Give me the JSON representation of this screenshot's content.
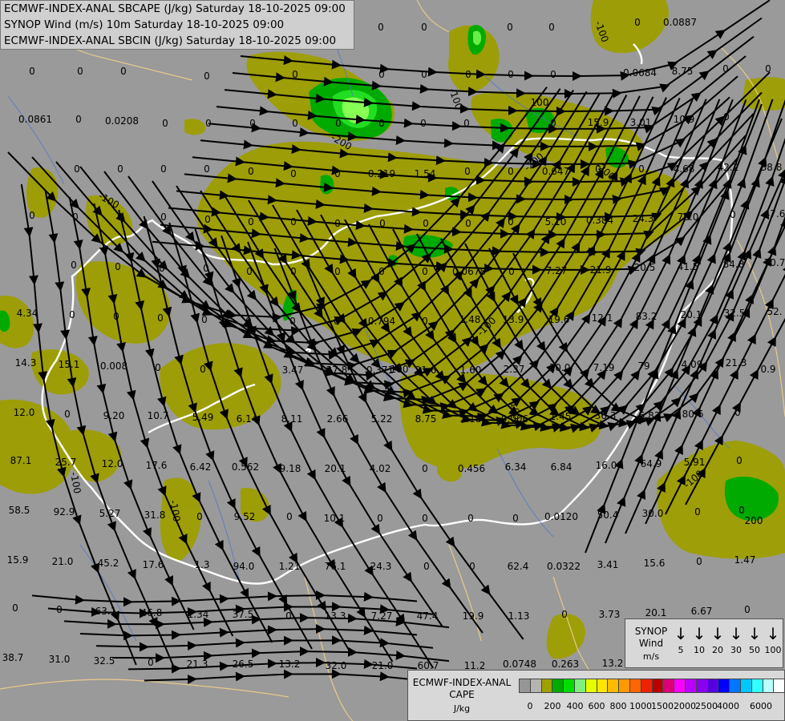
{
  "header": {
    "line1": "ECMWF-INDEX-ANAL SBCAPE (J/kg) Saturday 18-10-2025 09:00",
    "line2": "SYNOP Wind (m/s) 10m Saturday 18-10-2025 09:00",
    "line3": "ECMWF-INDEX-ANAL SBCIN (J/kg) Saturday 18-10-2025 09:00"
  },
  "station_values": [
    [
      "0",
      40,
      93
    ],
    [
      "0",
      100,
      93
    ],
    [
      "0",
      154,
      93
    ],
    [
      "0",
      258,
      99
    ],
    [
      "0",
      368,
      97
    ],
    [
      "0",
      475,
      38
    ],
    [
      "0",
      529,
      38
    ],
    [
      "0",
      636,
      38
    ],
    [
      "0",
      688,
      38
    ],
    [
      "0",
      476,
      97
    ],
    [
      "0",
      529,
      97
    ],
    [
      "0",
      584,
      97
    ],
    [
      "0",
      637,
      97
    ],
    [
      "0",
      690,
      97
    ],
    [
      "0.0887",
      848,
      32
    ],
    [
      "0",
      795,
      32
    ],
    [
      "0.0684",
      798,
      95
    ],
    [
      "8.75",
      851,
      93
    ],
    [
      "0",
      905,
      90
    ],
    [
      "0",
      958,
      90
    ],
    [
      "0.0861",
      44,
      153
    ],
    [
      "0",
      98,
      153
    ],
    [
      "0.0208",
      152,
      155
    ],
    [
      "0",
      206,
      158
    ],
    [
      "0",
      260,
      158
    ],
    [
      "0",
      315,
      158
    ],
    [
      "0",
      368,
      158
    ],
    [
      "0",
      422,
      158
    ],
    [
      "0",
      476,
      158
    ],
    [
      "0",
      528,
      158
    ],
    [
      "0",
      582,
      158
    ],
    [
      "100",
      673,
      132
    ],
    [
      "0",
      690,
      158
    ],
    [
      "15.9",
      746,
      157
    ],
    [
      "3.01",
      799,
      157
    ],
    [
      "10.9",
      853,
      153
    ],
    [
      "0",
      906,
      150
    ],
    [
      "0",
      96,
      215
    ],
    [
      "0",
      150,
      215
    ],
    [
      "0",
      204,
      215
    ],
    [
      "0",
      258,
      215
    ],
    [
      "0",
      313,
      218
    ],
    [
      "0",
      366,
      221
    ],
    [
      "0",
      421,
      221
    ],
    [
      "0.219",
      476,
      221
    ],
    [
      "1.54",
      530,
      221
    ],
    [
      "0",
      583,
      218
    ],
    [
      "0",
      637,
      218
    ],
    [
      "0.647",
      693,
      218
    ],
    [
      "0",
      746,
      215
    ],
    [
      "0",
      800,
      215
    ],
    [
      "4.68",
      853,
      215
    ],
    [
      "42.2",
      908,
      213
    ],
    [
      "38.8",
      962,
      213
    ],
    [
      "0",
      40,
      273
    ],
    [
      "0",
      94,
      275
    ],
    [
      "0",
      150,
      275
    ],
    [
      "0",
      204,
      275
    ],
    [
      "0",
      259,
      278
    ],
    [
      "0",
      313,
      281
    ],
    [
      "0",
      366,
      281
    ],
    [
      "0",
      421,
      283
    ],
    [
      "0",
      477,
      283
    ],
    [
      "0",
      531,
      283
    ],
    [
      "0",
      584,
      283
    ],
    [
      "0",
      637,
      281
    ],
    [
      "5.10",
      693,
      281
    ],
    [
      "0.384",
      748,
      279
    ],
    [
      "24.3",
      802,
      277
    ],
    [
      "76.0",
      858,
      275
    ],
    [
      "0",
      914,
      272
    ],
    [
      "47.6",
      966,
      271
    ],
    [
      "0",
      92,
      335
    ],
    [
      "0",
      147,
      337
    ],
    [
      "0",
      202,
      339
    ],
    [
      "0",
      257,
      339
    ],
    [
      "0",
      311,
      343
    ],
    [
      "0",
      366,
      343
    ],
    [
      "0",
      421,
      343
    ],
    [
      "0",
      476,
      343
    ],
    [
      "0",
      530,
      343
    ],
    [
      "0.0678",
      585,
      343
    ],
    [
      "0",
      638,
      343
    ],
    [
      "7.27",
      694,
      342
    ],
    [
      "21.9",
      749,
      341
    ],
    [
      "20.5",
      804,
      338
    ],
    [
      "41.5",
      858,
      337
    ],
    [
      "84.8",
      915,
      334
    ],
    [
      "70.7",
      966,
      332
    ],
    [
      "4.34",
      34,
      395
    ],
    [
      "0",
      90,
      397
    ],
    [
      "0",
      145,
      399
    ],
    [
      "0",
      200,
      401
    ],
    [
      "0",
      255,
      403
    ],
    [
      "0",
      310,
      405
    ],
    [
      "0",
      365,
      405
    ],
    [
      "0",
      420,
      405
    ],
    [
      "0.794",
      476,
      405
    ],
    [
      "0",
      530,
      405
    ],
    [
      "1.48",
      586,
      403
    ],
    [
      "13.9",
      640,
      403
    ],
    [
      "19.6",
      697,
      403
    ],
    [
      "12.1",
      751,
      401
    ],
    [
      "83.2",
      806,
      399
    ],
    [
      "20.1",
      862,
      397
    ],
    [
      "32.5",
      916,
      395
    ],
    [
      "52.",
      966,
      393
    ],
    [
      "14.3",
      32,
      457
    ],
    [
      "15.1",
      86,
      459
    ],
    [
      "0.008",
      142,
      461
    ],
    [
      "0",
      197,
      463
    ],
    [
      "0",
      253,
      465
    ],
    [
      "3.47",
      365,
      466
    ],
    [
      "27.8",
      420,
      466
    ],
    [
      "0.371",
      474,
      466
    ],
    [
      "100",
      498,
      465
    ],
    [
      "21.6",
      531,
      466
    ],
    [
      "1.60",
      587,
      466
    ],
    [
      "2.37",
      641,
      465
    ],
    [
      "10.0",
      698,
      463
    ],
    [
      "7.19",
      753,
      463
    ],
    [
      "79",
      803,
      461
    ],
    [
      "4.09",
      863,
      459
    ],
    [
      "21.3",
      918,
      457
    ],
    [
      "0.9",
      958,
      465
    ],
    [
      "12.0",
      30,
      519
    ],
    [
      "0",
      84,
      521
    ],
    [
      "9.20",
      142,
      523
    ],
    [
      "10.7",
      197,
      523
    ],
    [
      "5.49",
      253,
      525
    ],
    [
      "6.14",
      308,
      527
    ],
    [
      "8.11",
      364,
      527
    ],
    [
      "2.66",
      421,
      527
    ],
    [
      "5.22",
      476,
      527
    ],
    [
      "8.75",
      531,
      527
    ],
    [
      "2.18",
      587,
      527
    ],
    [
      "0.006",
      642,
      527
    ],
    [
      "1.45",
      699,
      524
    ],
    [
      "36.3",
      755,
      523
    ],
    [
      "6.83",
      810,
      523
    ],
    [
      "80.6",
      864,
      521
    ],
    [
      "0",
      920,
      519
    ],
    [
      "87.1",
      26,
      579
    ],
    [
      "25.7",
      82,
      581
    ],
    [
      "12.0",
      140,
      583
    ],
    [
      "17.6",
      195,
      585
    ],
    [
      "6.42",
      250,
      587
    ],
    [
      "0.562",
      306,
      587
    ],
    [
      "9.18",
      362,
      589
    ],
    [
      "20.1",
      418,
      589
    ],
    [
      "4.02",
      474,
      589
    ],
    [
      "0",
      530,
      589
    ],
    [
      "0.456",
      588,
      589
    ],
    [
      "6.34",
      643,
      587
    ],
    [
      "6.84",
      700,
      587
    ],
    [
      "16.0",
      756,
      585
    ],
    [
      "64.9",
      812,
      583
    ],
    [
      "5.91",
      866,
      581
    ],
    [
      "0",
      922,
      579
    ],
    [
      "58.5",
      24,
      641
    ],
    [
      "92.9",
      80,
      643
    ],
    [
      "5.27",
      137,
      645
    ],
    [
      "31.8",
      193,
      647
    ],
    [
      "0",
      249,
      649
    ],
    [
      "9.52",
      305,
      649
    ],
    [
      "0",
      361,
      649
    ],
    [
      "10.1",
      417,
      651
    ],
    [
      "0",
      474,
      651
    ],
    [
      "0",
      530,
      651
    ],
    [
      "0",
      587,
      651
    ],
    [
      "0",
      643,
      651
    ],
    [
      "0.0120",
      700,
      649
    ],
    [
      "50.4",
      758,
      647
    ],
    [
      "30.0",
      814,
      645
    ],
    [
      "0",
      870,
      643
    ],
    [
      "0",
      925,
      641
    ],
    [
      "200",
      940,
      654
    ],
    [
      "15.9",
      22,
      703
    ],
    [
      "21.0",
      78,
      705
    ],
    [
      "45.2",
      135,
      707
    ],
    [
      "17.6",
      191,
      709
    ],
    [
      "1.3",
      252,
      709
    ],
    [
      "94.0",
      304,
      711
    ],
    [
      "1.21",
      361,
      711
    ],
    [
      "76.1",
      418,
      711
    ],
    [
      "24.3",
      475,
      711
    ],
    [
      "0",
      532,
      711
    ],
    [
      "0",
      589,
      711
    ],
    [
      "62.4",
      646,
      711
    ],
    [
      "0.0322",
      703,
      711
    ],
    [
      "3.41",
      758,
      709
    ],
    [
      "15.6",
      816,
      707
    ],
    [
      "0",
      872,
      705
    ],
    [
      "1.47",
      929,
      703
    ],
    [
      "0",
      19,
      763
    ],
    [
      "0",
      74,
      765
    ],
    [
      "63.1",
      132,
      767
    ],
    [
      "46.8",
      189,
      769
    ],
    [
      "1.34",
      247,
      771
    ],
    [
      "37.5",
      303,
      771
    ],
    [
      "0",
      360,
      773
    ],
    [
      "13.3",
      418,
      773
    ],
    [
      "7.27",
      476,
      773
    ],
    [
      "47.4",
      533,
      773
    ],
    [
      "19.9",
      590,
      773
    ],
    [
      "1.13",
      647,
      773
    ],
    [
      "0",
      704,
      771
    ],
    [
      "3.73",
      760,
      771
    ],
    [
      "20.1",
      818,
      769
    ],
    [
      "6.67",
      875,
      767
    ],
    [
      "0",
      932,
      765
    ],
    [
      "38.7",
      16,
      825
    ],
    [
      "31.0",
      74,
      827
    ],
    [
      "32.5",
      130,
      829
    ],
    [
      "0",
      188,
      831
    ],
    [
      "21.3",
      246,
      833
    ],
    [
      "26.5",
      303,
      833
    ],
    [
      "13.2",
      361,
      833
    ],
    [
      "32.0",
      419,
      835
    ],
    [
      "21.0",
      477,
      835
    ],
    [
      "60.7",
      534,
      835
    ],
    [
      "11.2",
      592,
      835
    ],
    [
      "0.0748",
      648,
      833
    ],
    [
      "0.263",
      705,
      833
    ],
    [
      "13.2",
      764,
      832
    ],
    [
      "0",
      820,
      829
    ]
  ],
  "synop_legend": {
    "title_line1": "SYNOP",
    "title_line2": "Wind",
    "unit": "m/s",
    "speeds": [
      "5",
      "10",
      "20",
      "30",
      "50",
      "100"
    ]
  },
  "cape_legend": {
    "title_line1": "ECMWF-INDEX-ANAL",
    "title_line2": "CAPE",
    "unit": "J/kg",
    "colors": [
      "#969696",
      "#b4b4b4",
      "#a0a000",
      "#00aa00",
      "#00dd00",
      "#7ef07e",
      "#e6ff00",
      "#ffe600",
      "#ffbb00",
      "#ff9900",
      "#ff6600",
      "#ee2200",
      "#bb0000",
      "#dd0077",
      "#ff00ff",
      "#bb00ff",
      "#8800ee",
      "#5500dd",
      "#0000ff",
      "#0077ff",
      "#00c8ff",
      "#33ffff",
      "#bbffff",
      "#ffffff"
    ],
    "ticks": [
      "0",
      "200",
      "400",
      "600",
      "800",
      "1000",
      "1500",
      "2000",
      "2500",
      "4000",
      "6000"
    ]
  }
}
